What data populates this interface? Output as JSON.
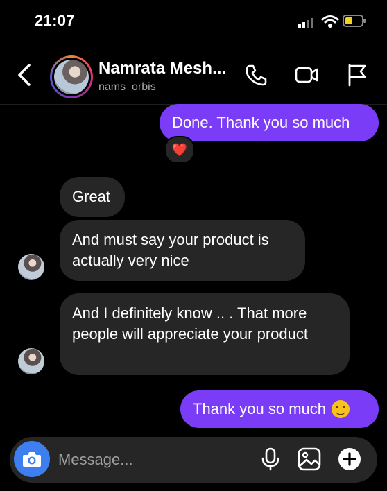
{
  "status_bar": {
    "time": "21:07"
  },
  "header": {
    "contact_name": "Namrata Mesh...",
    "username": "nams_orbis",
    "icons": [
      "back-chevron-icon",
      "phone-icon",
      "video-camera-icon",
      "flag-icon"
    ]
  },
  "messages": [
    {
      "sender": "me",
      "text": "Done. Thank you so much",
      "reaction": "❤️"
    },
    {
      "sender": "contact",
      "text": "Great"
    },
    {
      "sender": "contact",
      "text": "And must say your product is actually very nice"
    },
    {
      "sender": "contact",
      "text": "And I definitely know .. . That more people will appreciate your product"
    },
    {
      "sender": "me",
      "text": "Thank you so much",
      "emoji": "smiling-face"
    }
  ],
  "composer": {
    "placeholder": "Message...",
    "icons": [
      "camera-icon",
      "microphone-icon",
      "gallery-icon",
      "add-icon"
    ]
  },
  "colors": {
    "background": "#000000",
    "outgoing_bubble": "#7b3cf7",
    "incoming_bubble": "#262626",
    "camera_button": "#3d7ef0",
    "secondary_text": "#a8a8a8"
  }
}
